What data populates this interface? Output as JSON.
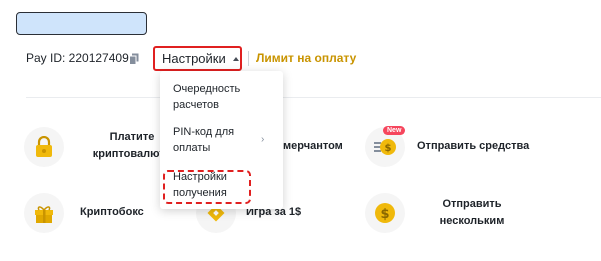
{
  "header": {
    "pay_id": "Pay ID: 220127409",
    "settings_label": "Настройки",
    "limit_label": "Лимит на оплату"
  },
  "menu": {
    "items": [
      {
        "label_line1": "Очередность",
        "label_line2": "расчетов"
      },
      {
        "label_line1": "PIN-код для",
        "label_line2": "оплаты"
      },
      {
        "label_line1": "Настройки",
        "label_line2": "получения"
      }
    ],
    "submenu_indicator": "›"
  },
  "tiles": {
    "pay_crypto": {
      "line1": "Платите",
      "line2": "криптовалюто"
    },
    "merchant": {
      "label": "мерчантом"
    },
    "send_funds": {
      "label": "Отправить средства",
      "badge": "New"
    },
    "cryptobox": {
      "label": "Криптобокс"
    },
    "game": {
      "label": "Игра за 1$"
    },
    "send_multiple": {
      "line1": "Отправить",
      "line2": "нескольким"
    }
  },
  "colors": {
    "accent_gold": "#c99400",
    "icon_gold": "#f0b90b",
    "highlight_red": "#e02020",
    "badge_red": "#f6465d"
  },
  "icons": [
    "copy-icon",
    "lock-icon",
    "gift-box-icon",
    "diamond-icon",
    "fast-coin-icon",
    "coin-icon"
  ]
}
